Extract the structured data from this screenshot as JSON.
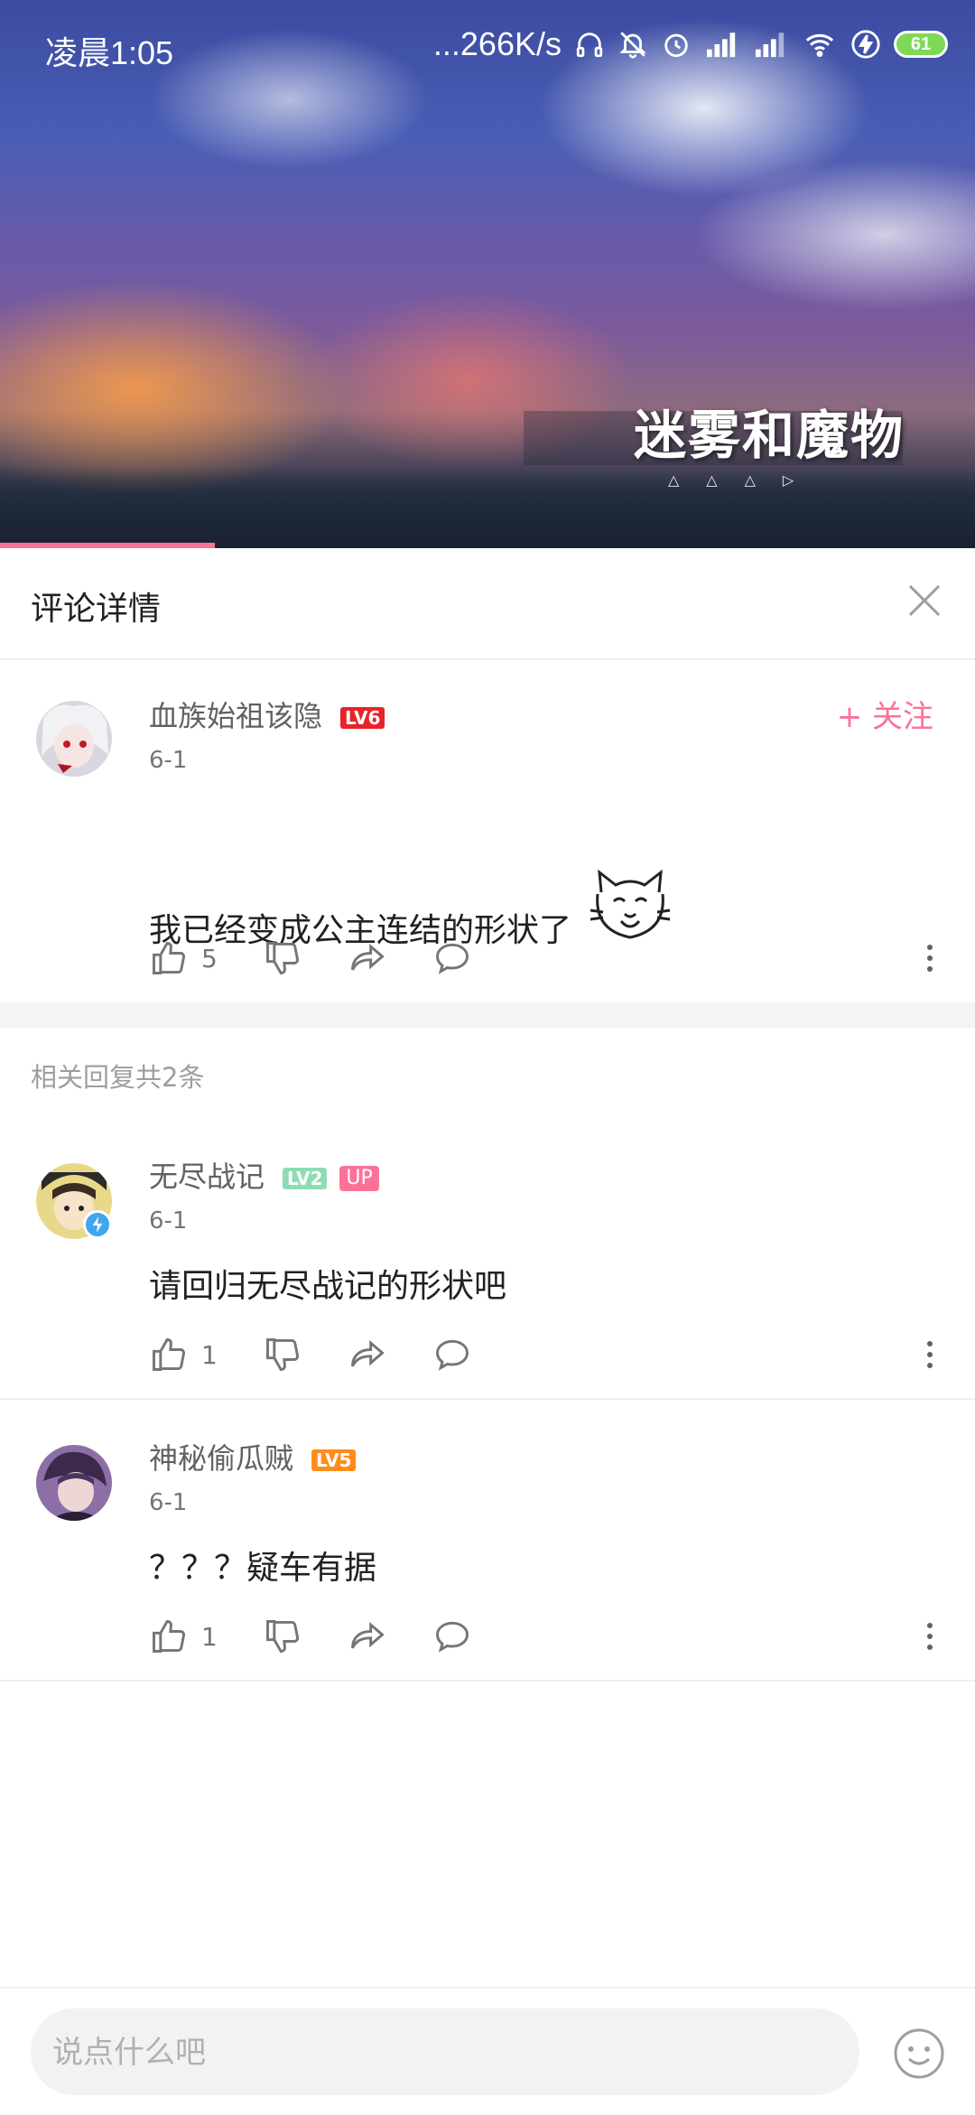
{
  "status_bar": {
    "time": "凌晨1:05",
    "net_speed": "...266K/s",
    "battery": "61"
  },
  "video": {
    "caption": "迷雾和魔物",
    "caption_marks": "△△△▷",
    "progress_fraction": 0.22
  },
  "panel": {
    "title": "评论详情"
  },
  "main_comment": {
    "username": "血族始祖该隐",
    "level": "LV6",
    "date": "6-1",
    "follow_label": "+ 关注",
    "text": "我已经变成公主连结的形状了",
    "like_count": "5"
  },
  "replies": {
    "header": "相关回复共2条",
    "items": [
      {
        "username": "无尽战记",
        "level": "LV2",
        "badge": "UP",
        "date": "6-1",
        "text": "请回归无尽战记的形状吧",
        "like_count": "1"
      },
      {
        "username": "神秘偷瓜贼",
        "level": "LV5",
        "date": "6-1",
        "text": "？？？疑车有据",
        "like_count": "1"
      }
    ]
  },
  "input": {
    "placeholder": "说点什么吧"
  },
  "colors": {
    "accent_pink": "#fb7299",
    "lv6": "#e8232b",
    "lv2": "#8fdcb3",
    "lv5": "#ff8c1a"
  },
  "icons": [
    "signal-icon",
    "wifi-icon",
    "headphones-icon",
    "mute-icon",
    "alarm-icon",
    "charging-icon",
    "battery-icon",
    "close-icon",
    "like-icon",
    "dislike-icon",
    "share-icon",
    "reply-icon",
    "more-icon",
    "emoji-icon",
    "cat-sticker"
  ]
}
